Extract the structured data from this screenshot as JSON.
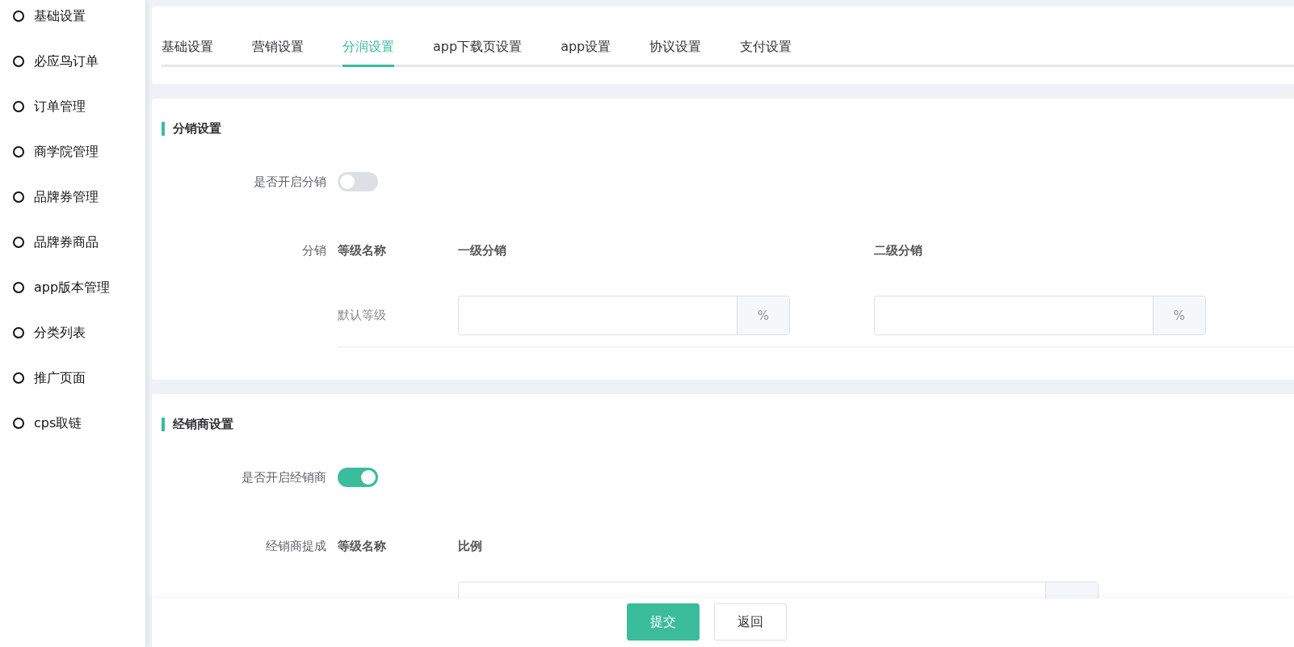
{
  "sidebar": {
    "items": [
      {
        "label": "基础设置"
      },
      {
        "label": "必应鸟订单"
      },
      {
        "label": "订单管理"
      },
      {
        "label": "商学院管理"
      },
      {
        "label": "品牌券管理"
      },
      {
        "label": "品牌券商品"
      },
      {
        "label": "app版本管理"
      },
      {
        "label": "分类列表"
      },
      {
        "label": "推广页面"
      },
      {
        "label": "cps取链"
      }
    ]
  },
  "tabs": [
    {
      "label": "基础设置",
      "selected": false
    },
    {
      "label": "营销设置",
      "selected": false
    },
    {
      "label": "分润设置",
      "selected": true
    },
    {
      "label": "app下载页设置",
      "selected": false
    },
    {
      "label": "app设置",
      "selected": false
    },
    {
      "label": "协议设置",
      "selected": false
    },
    {
      "label": "支付设置",
      "selected": false
    }
  ],
  "sections": [
    {
      "title": "分销设置",
      "toggle": {
        "label": "是否开启分销",
        "on": false
      },
      "table": {
        "label": "分销",
        "columns": [
          "等级名称",
          "一级分销",
          "二级分销"
        ],
        "rows": [
          {
            "name": "默认等级",
            "suffixes": [
              "%",
              "%"
            ]
          }
        ]
      }
    },
    {
      "title": "经销商设置",
      "toggle": {
        "label": "是否开启经销商",
        "on": true
      },
      "table": {
        "label": "经销商提成",
        "columns": [
          "等级名称",
          "比例"
        ],
        "rows": [
          {}
        ]
      }
    }
  ],
  "footer": {
    "buttons": [
      {
        "label": "提交",
        "kind": "primary"
      },
      {
        "label": "返回",
        "kind": "default"
      }
    ]
  }
}
